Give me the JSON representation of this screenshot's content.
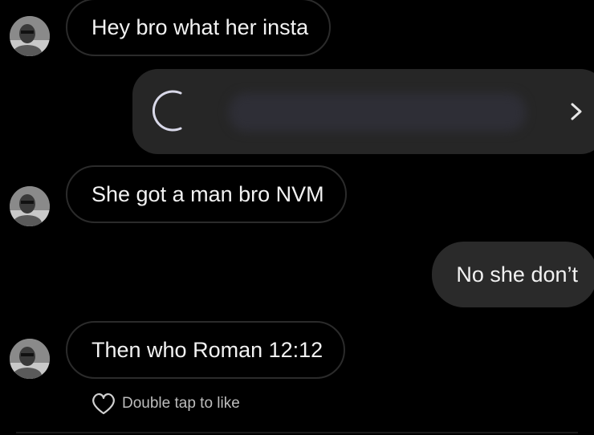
{
  "messages": {
    "m1": {
      "text": "Hey bro what her insta"
    },
    "m2": {
      "text": "She got a man bro NVM"
    },
    "m3": {
      "text": "No she don’t"
    },
    "m4": {
      "text": "Then who Roman 12:12"
    }
  },
  "shared_post": {
    "icon": "chevron-right-icon"
  },
  "like_hint": {
    "label": "Double tap to like",
    "icon": "heart-outline-icon"
  },
  "colors": {
    "background": "#000000",
    "incoming_border": "#2b2b2b",
    "outgoing_bubble": "#2a2a2a",
    "text": "#f2f2f2",
    "hint_text": "#bdbdbd"
  }
}
